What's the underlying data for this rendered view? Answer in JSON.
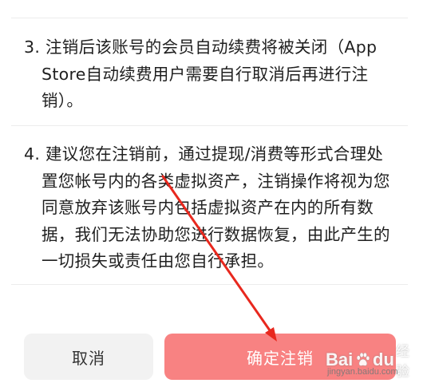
{
  "terms": {
    "item3": {
      "number": "3.",
      "lines": [
        "注销后该账号的会员自动续费将被关闭（App",
        "Store自动续费用户需要自行取消后再进行注",
        "销）。"
      ]
    },
    "item4": {
      "number": "4.",
      "lines": [
        "建议您在注销前，通过提现/消费等形式合理处",
        "置您帐号内的各类虚拟资产，注销操作将视为您",
        "同意放弃该账号内包括虚拟资产在内的所有数",
        "据，我们无法协助您进行数据恢复，由此产生的",
        "一切损失或责任由您自行承担。"
      ]
    }
  },
  "actions": {
    "cancel_label": "取消",
    "confirm_label": "确定注销"
  },
  "watermark": {
    "brand_left": "Bai",
    "brand_right": "du",
    "experience": "经验",
    "url": "jingyan.baidu.com"
  },
  "colors": {
    "confirm_bg": "#f88282",
    "cancel_bg": "#f2f2f2",
    "annotation_arrow": "#e8281e"
  },
  "icons": {
    "watermark_logo": "baidu-paw-icon",
    "annotation": "red-arrow-icon"
  }
}
